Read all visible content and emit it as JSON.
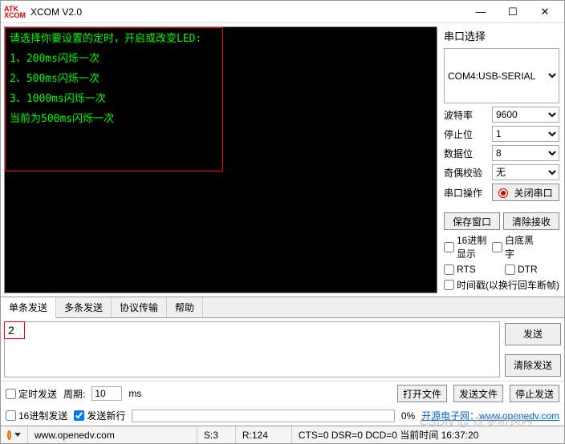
{
  "window": {
    "title": "XCOM V2.0"
  },
  "terminal": {
    "lines": [
      "请选择你要设置的定时，开启或改变LED:",
      "1、200ms闪烁一次",
      "2、500ms闪烁一次",
      "3、1000ms闪烁一次",
      "当前为500ms闪烁一次"
    ]
  },
  "sidebar": {
    "port_label": "串口选择",
    "port_value": "COM4:USB-SERIAL",
    "baud_label": "波特率",
    "baud_value": "9600",
    "stop_label": "停止位",
    "stop_value": "1",
    "data_label": "数据位",
    "data_value": "8",
    "parity_label": "奇偶校验",
    "parity_value": "无",
    "op_label": "串口操作",
    "op_button": "关闭串口",
    "save_window": "保存窗口",
    "clear_recv": "清除接收",
    "hex_display": "16进制显示",
    "white_bg": "白底黑字",
    "rts": "RTS",
    "dtr": "DTR",
    "timestamp": "时间戳(以换行回车断帧)"
  },
  "tabs": {
    "items": [
      "单条发送",
      "多条发送",
      "协议传输",
      "帮助"
    ]
  },
  "send": {
    "input_value": "2",
    "send_btn": "发送",
    "clear_btn": "清除发送",
    "timed": "定时发送",
    "period_label": "周期:",
    "period_value": "10",
    "period_unit": "ms",
    "open_file": "打开文件",
    "send_file": "发送文件",
    "stop_send": "停止发送",
    "hex_send": "16进制发送",
    "newline": "发送新行",
    "progress": "0%",
    "link_text": "开源电子网：www.openedv.com"
  },
  "status": {
    "url": "www.openedv.com",
    "sent": "S:3",
    "recv": "R:124",
    "lines": "CTS=0 DSR=0 DCD=0  当前时间 16:37:20"
  },
  "watermark": "CSDN @ 枕梦听风吟"
}
